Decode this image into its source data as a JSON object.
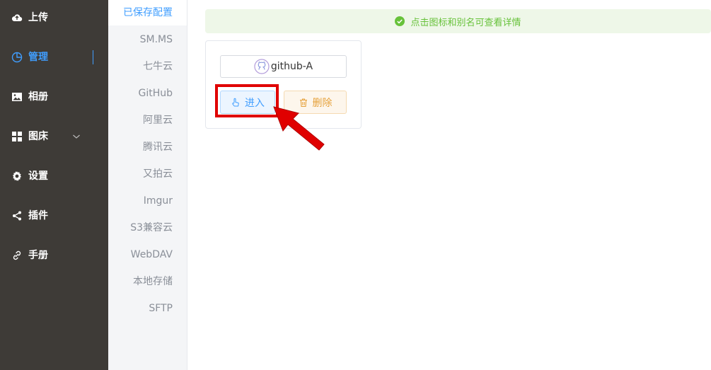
{
  "sidebar": {
    "items": [
      {
        "label": "上传",
        "icon": "cloud-upload-icon"
      },
      {
        "label": "管理",
        "icon": "pie-chart-icon",
        "active": true
      },
      {
        "label": "相册",
        "icon": "picture-icon"
      },
      {
        "label": "图床",
        "icon": "grid-icon",
        "hasSubmenu": true
      },
      {
        "label": "设置",
        "icon": "gear-icon"
      },
      {
        "label": "插件",
        "icon": "share-icon"
      },
      {
        "label": "手册",
        "icon": "link-icon"
      }
    ]
  },
  "subnav": {
    "items": [
      "已保存配置",
      "SM.MS",
      "七牛云",
      "GitHub",
      "阿里云",
      "腾讯云",
      "又拍云",
      "Imgur",
      "S3兼容云",
      "WebDAV",
      "本地存储",
      "SFTP"
    ],
    "selected": "已保存配置"
  },
  "notice": {
    "text": "点击图标和别名可查看详情"
  },
  "config_card": {
    "alias": "github-A",
    "enter_label": "进入",
    "delete_label": "删除"
  },
  "colors": {
    "sidebar_bg": "#3e3b37",
    "accent": "#409eff",
    "success": "#67c23a",
    "warning": "#e6a23c",
    "highlight": "#e00000"
  }
}
